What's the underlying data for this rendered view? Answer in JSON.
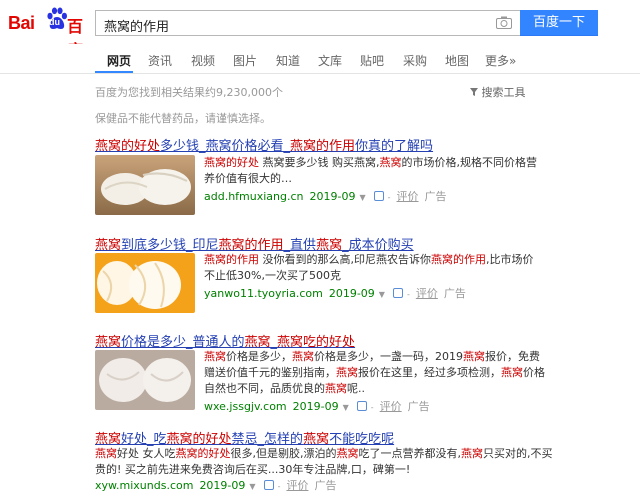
{
  "logo": {
    "latin": "Bai",
    "badge": "du",
    "cn": "百度"
  },
  "search": {
    "query": "燕窝的作用",
    "button": "百度一下"
  },
  "tabs": [
    "网页",
    "资讯",
    "视频",
    "图片",
    "知道",
    "文库",
    "贴吧",
    "采购",
    "地图",
    "更多»"
  ],
  "stats": "百度为您找到相关结果约9,230,000个",
  "tools": "搜索工具",
  "notice": "保健品不能代替药品，请谨慎选择。",
  "results": [
    {
      "title": [
        [
          "燕窝的好处",
          true
        ],
        [
          "多少钱_燕窝价格必看_",
          false
        ],
        [
          "燕窝的作用",
          true
        ],
        [
          "你真的了解吗",
          false
        ]
      ],
      "desc": [
        [
          [
            "燕窝的好处",
            true
          ],
          [
            " 燕窝要多少钱 购买燕窝,",
            false
          ],
          [
            "燕窝",
            true
          ],
          [
            "的市场价格,规格不同价格营",
            false
          ]
        ],
        [
          [
            "养价值有很大的…",
            false
          ]
        ]
      ],
      "url": "add.hfmuxiang.cn",
      "date": "2019-09",
      "rate": "评价",
      "ad": "广告"
    },
    {
      "title": [
        [
          "燕窝",
          true
        ],
        [
          "到底多少钱_印尼",
          false
        ],
        [
          "燕窝的作用",
          true
        ],
        [
          "_直供",
          false
        ],
        [
          "燕窝",
          true
        ],
        [
          "_成本价购买",
          false
        ]
      ],
      "desc": [
        [
          [
            "燕窝的作用",
            true
          ],
          [
            " 没你看到的那么高,印尼燕农告诉你",
            false
          ],
          [
            "燕窝的作用",
            true
          ],
          [
            ",比市场价",
            false
          ]
        ],
        [
          [
            "不止低30%,一次买了500克",
            false
          ]
        ]
      ],
      "url": "yanwo11.tyoyria.com",
      "date": "2019-09",
      "rate": "评价",
      "ad": "广告"
    },
    {
      "title": [
        [
          "燕窝",
          true
        ],
        [
          "价格是多少_普通人的",
          false
        ],
        [
          "燕窝",
          true
        ],
        [
          "_",
          false
        ],
        [
          "燕窝吃的好处",
          true
        ]
      ],
      "desc": [
        [
          [
            "燕窝",
            true
          ],
          [
            "价格是多少，",
            false
          ],
          [
            "燕窝",
            true
          ],
          [
            "价格是多少，一盏一码，2019",
            false
          ],
          [
            "燕窝",
            true
          ],
          [
            "报价，免费",
            false
          ]
        ],
        [
          [
            "赠送价值千元的鉴别指南，",
            false
          ],
          [
            "燕窝",
            true
          ],
          [
            "报价在这里，经过多项检测，",
            false
          ],
          [
            "燕窝",
            true
          ],
          [
            "价格",
            false
          ]
        ],
        [
          [
            "自然也不同，品质优良的",
            false
          ],
          [
            "燕窝",
            true
          ],
          [
            "呢..",
            false
          ]
        ]
      ],
      "url": "wxe.jssgjv.com",
      "date": "2019-09",
      "rate": "评价",
      "ad": "广告"
    },
    {
      "title": [
        [
          "燕窝",
          true
        ],
        [
          "好处_吃",
          false
        ],
        [
          "燕窝的好处",
          true
        ],
        [
          "禁忌_怎样的",
          false
        ],
        [
          "燕窝",
          true
        ],
        [
          "不能吃吃呢",
          false
        ]
      ],
      "desc": [
        [
          [
            "燕窝",
            true
          ],
          [
            "好处 女人吃",
            false
          ],
          [
            "燕窝的好处",
            true
          ],
          [
            "很多,但是剔胶,漂泊的",
            false
          ],
          [
            "燕窝",
            true
          ],
          [
            "吃了一点营养都没有,",
            false
          ],
          [
            "燕窝",
            true
          ],
          [
            "只买对的,不买",
            false
          ]
        ],
        [
          [
            "贵的! 买之前先进来免费咨询后在买...30年专注品牌,口，碑第一!",
            false
          ]
        ]
      ],
      "url": "xyw.mixunds.com",
      "date": "2019-09",
      "rate": "评价",
      "ad": "广告"
    }
  ],
  "colors": {
    "brand_red": "#e10602",
    "brand_blue": "#2932e1",
    "button_blue": "#3385ff",
    "link": "#2440b3",
    "highlight": "#c00",
    "url_green": "#008000"
  }
}
